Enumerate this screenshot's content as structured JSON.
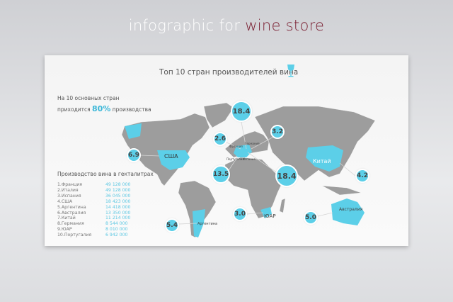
{
  "page_title": {
    "prefix": "infographic for ",
    "accent": "wine store"
  },
  "card": {
    "heading": "Топ 10 стран производителей вина",
    "heading_icon": "wine-glass-icon",
    "intro_line1": "На 10 основных стран",
    "intro_line2_pre": "приходится",
    "intro_pct": "80%",
    "intro_line2_post": "производства",
    "table_title": "Производство вина в гекталитрах",
    "table": [
      {
        "country": "1.Франция",
        "value": "49 128 000"
      },
      {
        "country": "2.Италия",
        "value": "49 128 000"
      },
      {
        "country": "3.Испания",
        "value": "36 045 000"
      },
      {
        "country": "4.США",
        "value": "18 423 000"
      },
      {
        "country": "5.Аргентина",
        "value": "14 418 000"
      },
      {
        "country": "6.Австралия",
        "value": "13 350 000"
      },
      {
        "country": "7.Китай",
        "value": "11 214 000"
      },
      {
        "country": "8.Германия",
        "value": "8 544 000"
      },
      {
        "country": "9.ЮАР",
        "value": "8 010 000"
      },
      {
        "country": "10.Португалия",
        "value": "6 942 000"
      }
    ],
    "bubbles": [
      "18.4",
      "2.6",
      "3.2",
      "6.9",
      "13.5",
      "18.4",
      "4.2",
      "5.4",
      "3.0",
      "5.0"
    ],
    "map_labels": {
      "usa": "США",
      "china": "Китай",
      "australia": "Австралия",
      "sa": "ЮАР",
      "argentina": "Аргентина",
      "france": "Франция",
      "germany": "Германия",
      "portugal": "Португалия",
      "spain": "Испания"
    },
    "colors": {
      "accent": "#5ccfe8",
      "land": "#9d9d9d",
      "wine": "#7a1f32"
    }
  }
}
